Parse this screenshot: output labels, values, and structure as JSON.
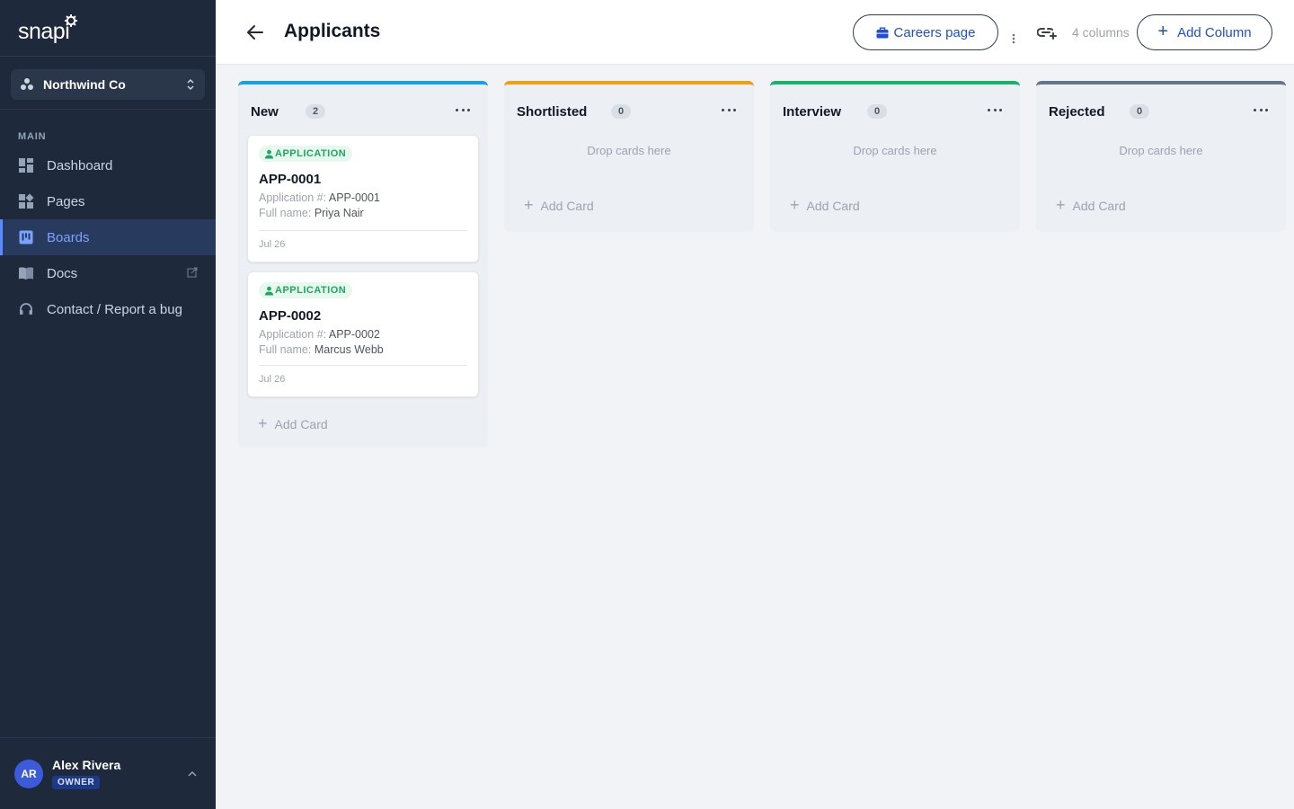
{
  "app": {
    "logo_text": "snapi"
  },
  "workspace": {
    "name": "Northwind Co"
  },
  "sidebar": {
    "section_label": "MAIN",
    "items": [
      {
        "label": "Dashboard",
        "icon": "dashboard-icon"
      },
      {
        "label": "Pages",
        "icon": "pages-icon"
      },
      {
        "label": "Boards",
        "icon": "boards-icon",
        "active": true
      },
      {
        "label": "Docs",
        "icon": "docs-icon",
        "external": true
      },
      {
        "label": "Contact / Report a bug",
        "icon": "headset-icon"
      }
    ]
  },
  "user": {
    "initials": "AR",
    "name": "Alex Rivera",
    "role": "OWNER"
  },
  "header": {
    "title": "Applicants",
    "careers_label": "Careers page",
    "columns_count": "4 columns",
    "add_column_label": "Add Column"
  },
  "colors": {
    "new": "#1a9fe0",
    "shortlisted": "#f29d16",
    "interview": "#16b26a",
    "rejected": "#64748b",
    "accent": "#1d4ed8",
    "tag_green": "#20a562"
  },
  "board": {
    "columns": [
      {
        "title": "New",
        "count": "2",
        "add_label": "Add Card",
        "cards": [
          {
            "tag": "APPLICATION",
            "title": "APP-0001",
            "fields": [
              {
                "label": "Application #:",
                "value": "APP-0001"
              },
              {
                "label": "Full name:",
                "value": "Priya Nair"
              }
            ],
            "date": "Jul 26"
          },
          {
            "tag": "APPLICATION",
            "title": "APP-0002",
            "fields": [
              {
                "label": "Application #:",
                "value": "APP-0002"
              },
              {
                "label": "Full name:",
                "value": "Marcus Webb"
              }
            ],
            "date": "Jul 26"
          }
        ]
      },
      {
        "title": "Shortlisted",
        "count": "0",
        "drop_hint": "Drop cards here",
        "add_label": "Add Card"
      },
      {
        "title": "Interview",
        "count": "0",
        "drop_hint": "Drop cards here",
        "add_label": "Add Card"
      },
      {
        "title": "Rejected",
        "count": "0",
        "drop_hint": "Drop cards here",
        "add_label": "Add Card"
      }
    ]
  }
}
